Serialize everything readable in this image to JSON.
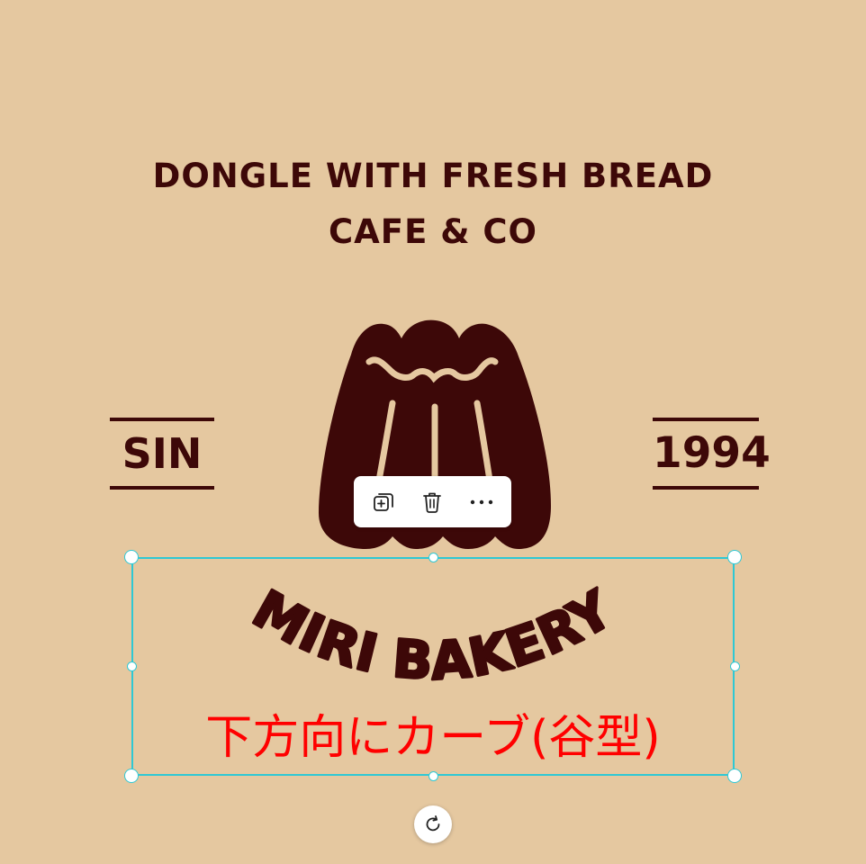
{
  "design": {
    "headline_line1": "DONGLE WITH FRESH BREAD",
    "headline_line2": "CAFE & CO",
    "left_badge": "SIN",
    "right_badge": "1994",
    "curved_title": "MIRI BAKERY",
    "annotation": "下方向にカーブ(谷型)",
    "logo_icon": "pudding-bread-icon"
  },
  "colors": {
    "background": "#e5c8a0",
    "ink": "#3d0808",
    "selection": "#2fc8d4",
    "annotation": "#ff0000"
  },
  "toolbar": {
    "icons": [
      "duplicate-icon",
      "trash-icon",
      "more-icon"
    ]
  },
  "controls": {
    "rotate_icon": "rotate-icon"
  }
}
